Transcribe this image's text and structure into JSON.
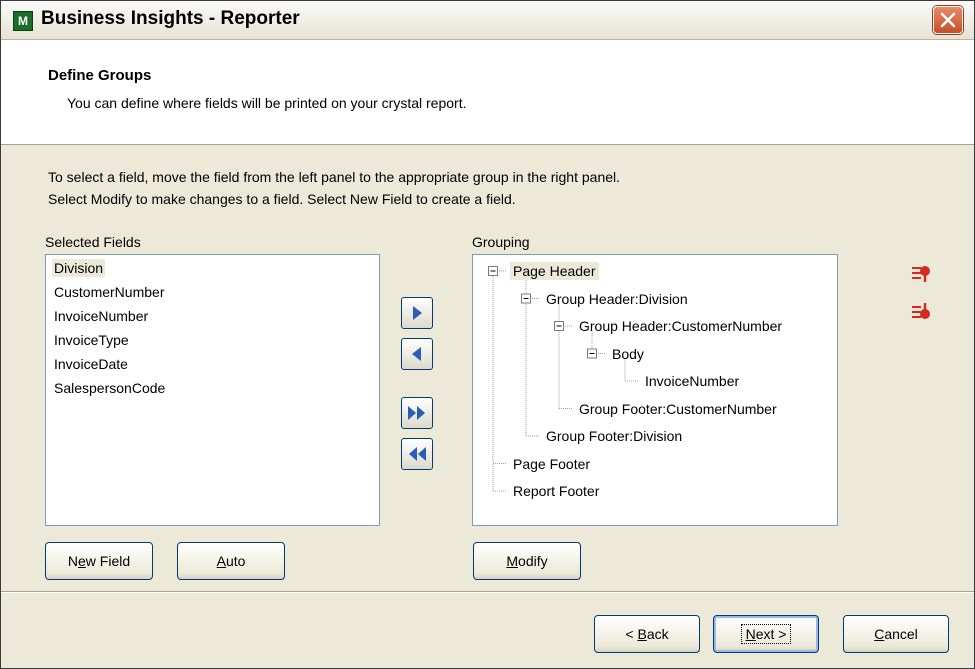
{
  "window": {
    "title": "Business Insights - Reporter",
    "app_icon_letter": "M"
  },
  "header": {
    "title": "Define Groups",
    "subtitle": "You can define where fields will be printed on your crystal report."
  },
  "instructions": {
    "line1": "To select a field, move the field from the left panel to the appropriate group in the right panel.",
    "line2": "Select Modify to make changes to a field.  Select New Field to create a field."
  },
  "selected_fields": {
    "label": "Selected Fields",
    "items": [
      "Division",
      "CustomerNumber",
      "InvoiceNumber",
      "InvoiceType",
      "InvoiceDate",
      "SalespersonCode"
    ],
    "selected_index": 0
  },
  "grouping": {
    "label": "Grouping",
    "nodes": [
      {
        "label": "Page Header",
        "level": 0,
        "expander": "minus",
        "selected": true
      },
      {
        "label": "Group Header:Division",
        "level": 1,
        "expander": "minus"
      },
      {
        "label": "Group Header:CustomerNumber",
        "level": 2,
        "expander": "minus"
      },
      {
        "label": "Body",
        "level": 3,
        "expander": "minus"
      },
      {
        "label": "InvoiceNumber",
        "level": 4,
        "expander": "none"
      },
      {
        "label": "Group Footer:CustomerNumber",
        "level": 2,
        "expander": "none"
      },
      {
        "label": "Group Footer:Division",
        "level": 1,
        "expander": "none"
      },
      {
        "label": "Page Footer",
        "level": 0,
        "expander": "none"
      },
      {
        "label": "Report Footer",
        "level": 0,
        "expander": "none"
      }
    ]
  },
  "move_buttons": [
    {
      "name": "move-right-button",
      "icon": "arrow-right-icon"
    },
    {
      "name": "move-left-button",
      "icon": "arrow-left-icon"
    },
    {
      "name": "move-all-right-button",
      "icon": "double-arrow-right-icon"
    },
    {
      "name": "move-all-left-button",
      "icon": "double-arrow-left-icon"
    }
  ],
  "side_icons": [
    "move-up-icon",
    "move-down-icon"
  ],
  "buttons": {
    "new_field": {
      "pre": "N",
      "ul": "e",
      "post": "w Field"
    },
    "auto": {
      "pre": "",
      "ul": "A",
      "post": "uto"
    },
    "modify": {
      "pre": "",
      "ul": "M",
      "post": "odify"
    },
    "back": {
      "pre": "< ",
      "ul": "B",
      "post": "ack"
    },
    "next": {
      "pre": "",
      "ul": "N",
      "post": "ext >"
    },
    "cancel": {
      "pre": "",
      "ul": "C",
      "post": "ancel"
    }
  },
  "colors": {
    "dialog_bg": "#ece9d8",
    "arrow_blue": "#2a5db8",
    "side_icon_red": "#d42a1e",
    "button_border": "#003c74"
  }
}
